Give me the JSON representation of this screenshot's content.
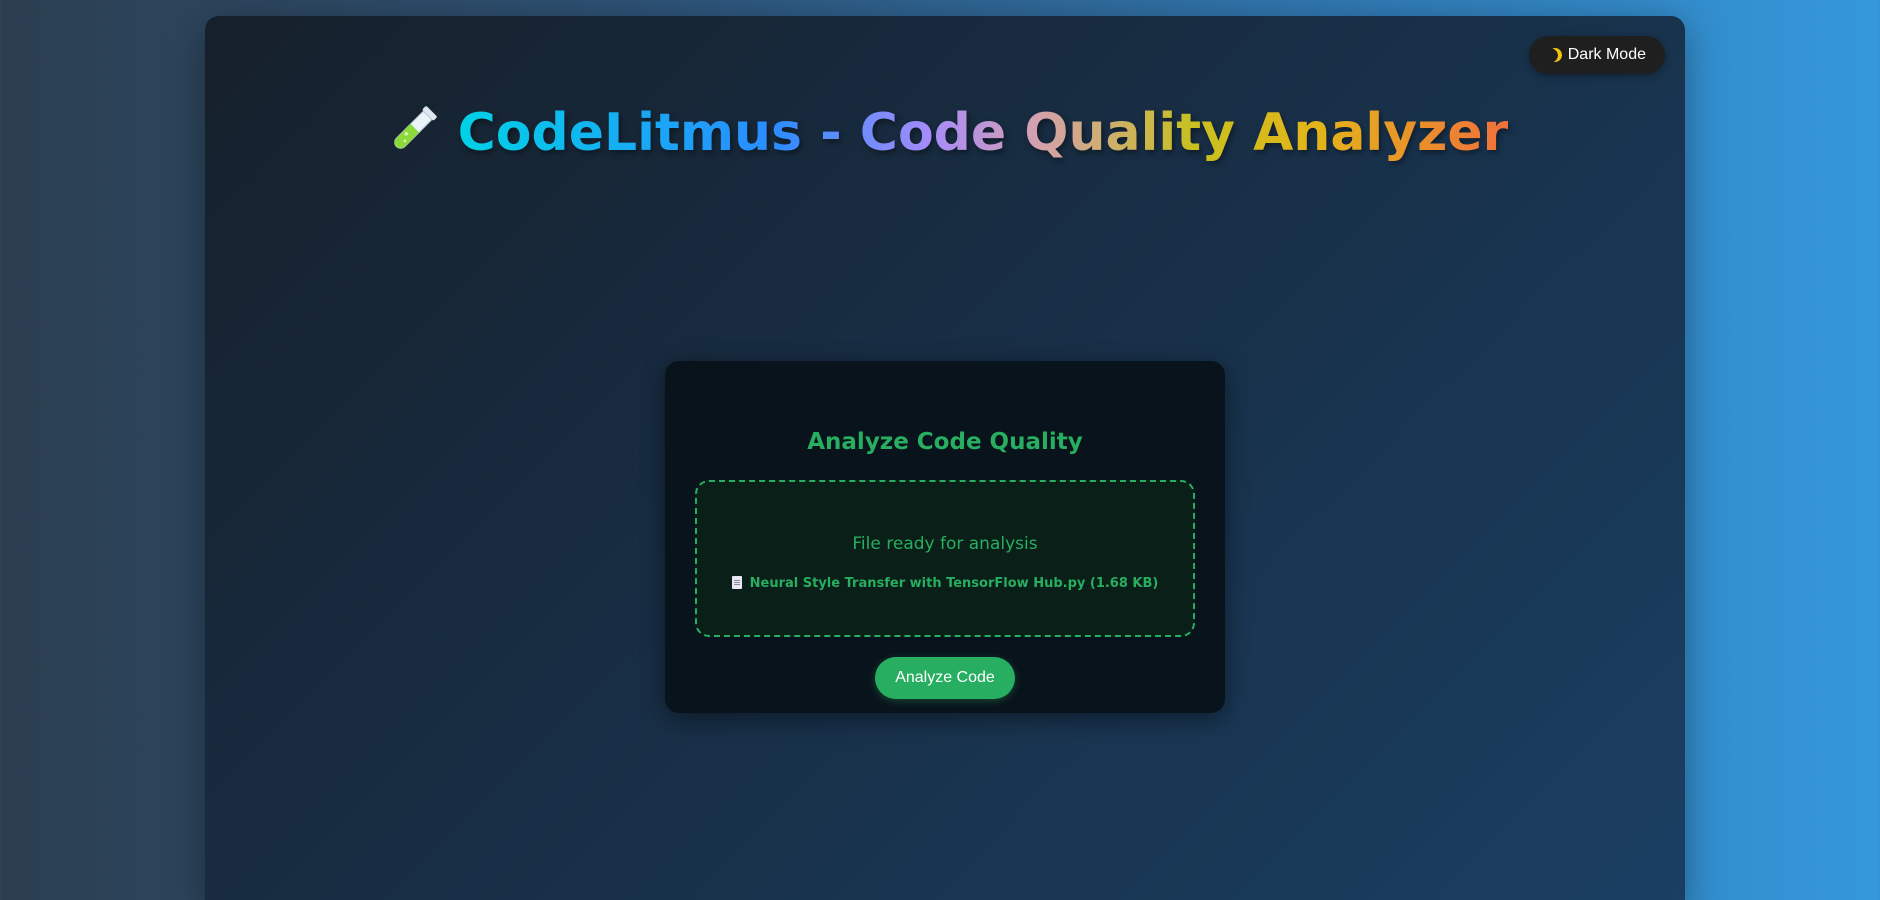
{
  "header": {
    "theme_toggle_label": "Dark Mode",
    "theme_toggle_icon": "moon-icon",
    "title": "CodeLitmus - Code Quality Analyzer",
    "title_icon": "test-tube-icon"
  },
  "card": {
    "title": "Analyze Code Quality",
    "drop_zone": {
      "status": "File ready for analysis",
      "file_icon": "document-icon",
      "file_label": "Neural Style Transfer with TensorFlow Hub.py (1.68 KB)"
    },
    "analyze_button_label": "Analyze Code"
  },
  "colors": {
    "accent": "#27ae60",
    "card_background": "#09131b",
    "toggle_background": "#1f1f1f"
  }
}
